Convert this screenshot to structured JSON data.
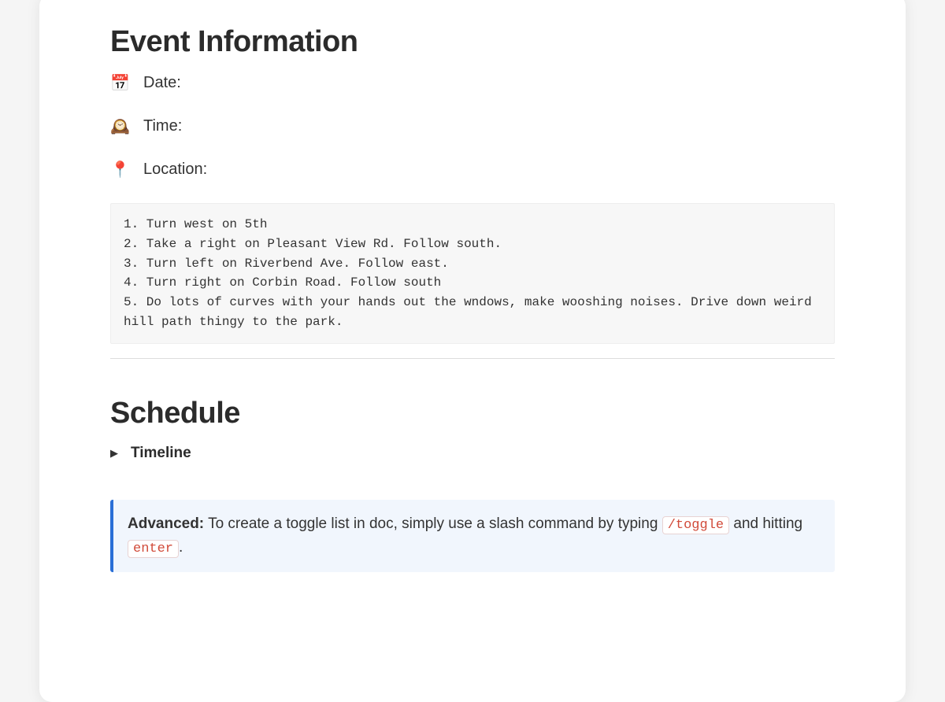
{
  "sections": {
    "event_info": {
      "heading": "Event Information",
      "rows": [
        {
          "icon": "📅",
          "label": "Date:"
        },
        {
          "icon": "🕰️",
          "label": "Time:"
        },
        {
          "icon": "📍",
          "label": "Location:"
        }
      ],
      "directions": "1. Turn west on 5th\n2. Take a right on Pleasant View Rd. Follow south.\n3. Turn left on Riverbend Ave. Follow east.\n4. Turn right on Corbin Road. Follow south\n5. Do lots of curves with your hands out the wndows, make wooshing noises. Drive down weird hill path thingy to the park."
    },
    "schedule": {
      "heading": "Schedule",
      "toggle_label": "Timeline"
    },
    "callout": {
      "bold": "Advanced:",
      "text_before": " To create a toggle list in doc, simply use a slash command by typing ",
      "code1": "/toggle",
      "text_mid": " and hitting ",
      "code2": "enter",
      "text_after": "."
    }
  }
}
